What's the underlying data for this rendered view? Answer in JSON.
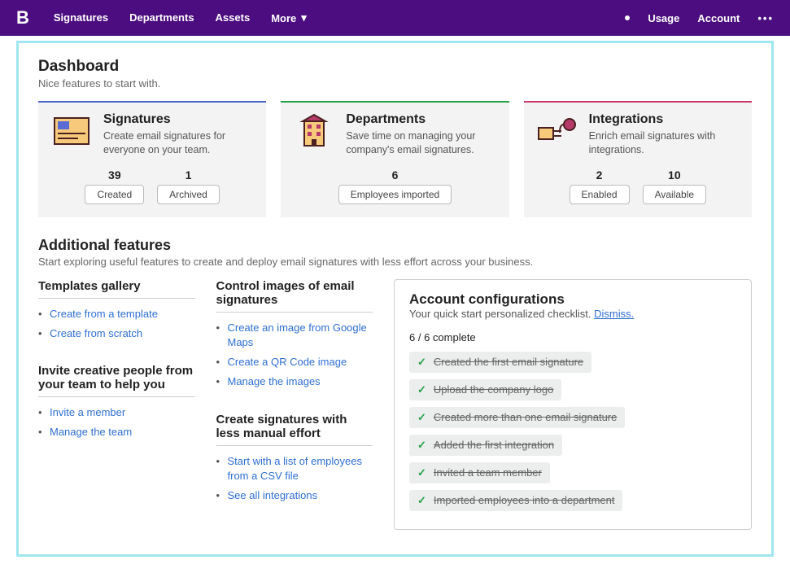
{
  "topbar": {
    "logo": "B",
    "nav": [
      "Signatures",
      "Departments",
      "Assets",
      "More"
    ],
    "right": [
      "Usage",
      "Account"
    ]
  },
  "dashboard": {
    "title": "Dashboard",
    "subtitle": "Nice features to start with."
  },
  "cards": [
    {
      "title": "Signatures",
      "desc": "Create email signatures for everyone on your team.",
      "stats": [
        {
          "num": "39",
          "label": "Created"
        },
        {
          "num": "1",
          "label": "Archived"
        }
      ]
    },
    {
      "title": "Departments",
      "desc": "Save time on managing your company's email signatures.",
      "stats": [
        {
          "num": "6",
          "label": "Employees imported"
        }
      ]
    },
    {
      "title": "Integrations",
      "desc": "Enrich email signatures with integrations.",
      "stats": [
        {
          "num": "2",
          "label": "Enabled"
        },
        {
          "num": "10",
          "label": "Available"
        }
      ]
    }
  ],
  "additional": {
    "title": "Additional features",
    "subtitle": "Start exploring useful features to create and deploy email signatures with less effort across your business."
  },
  "features": {
    "templates": {
      "title": "Templates gallery",
      "links": [
        "Create from a template",
        "Create from scratch"
      ]
    },
    "images": {
      "title": "Control images of email signatures",
      "links": [
        "Create an image from Google Maps",
        "Create a QR Code image",
        "Manage the images"
      ]
    },
    "invite": {
      "title": "Invite creative people from your team to help you",
      "links": [
        "Invite a member",
        "Manage the team"
      ]
    },
    "effort": {
      "title": "Create signatures with less manual effort",
      "links": [
        "Start with a list of employees from a CSV file",
        "See all integrations"
      ]
    }
  },
  "config": {
    "title": "Account configurations",
    "subtitle": "Your quick start personalized checklist. ",
    "dismiss": "Dismiss.",
    "progress": "6 / 6 complete",
    "items": [
      "Created the first email signature",
      "Upload the company logo",
      "Created more than one email signature",
      "Added the first integration",
      "Invited a team member",
      "Imported employees into a department"
    ]
  }
}
